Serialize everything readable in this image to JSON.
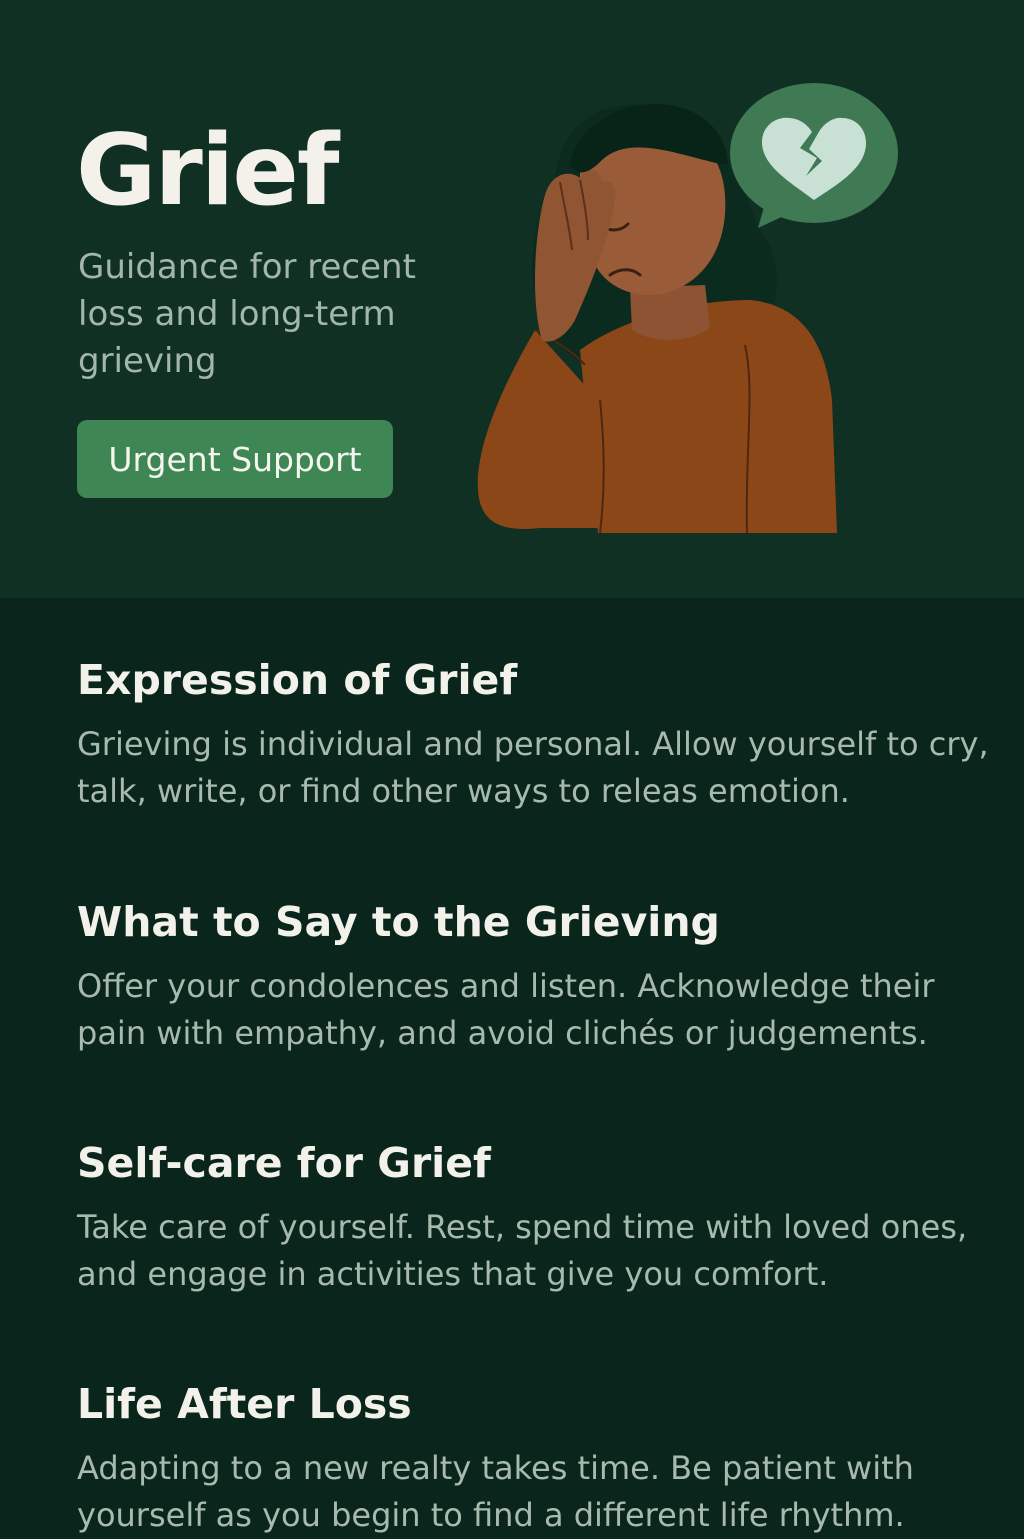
{
  "hero": {
    "title": "Grief",
    "subtitle": "Guidance for recent loss and long-term grieving",
    "urgent_button_label": "Urgent Support",
    "illustration_icon": "broken-heart-icon"
  },
  "sections": [
    {
      "heading": "Expression of Grief",
      "body": "Grieving is individual and personal. Allow yourself to cry, talk, write, or find other ways to releas emotion."
    },
    {
      "heading": "What to Say to the Grieving",
      "body": "Offer your condolences and listen. Acknowledge their pain with empathy, and avoid clichés or judgements."
    },
    {
      "heading": "Self-care for Grief",
      "body": "Take care of yourself. Rest, spend time with loved ones, and engage in activities that give you comfort."
    },
    {
      "heading": "Life After Loss",
      "body": "Adapting to a new realty takes time. Be patient with yourself as you begin to find a different life rhythm."
    }
  ],
  "colors": {
    "page_background": "#0a261c",
    "hero_background": "#0f3023",
    "button_green": "#3e8653",
    "heading_text": "#f2f1ea",
    "body_text": "#a8b9ad"
  }
}
